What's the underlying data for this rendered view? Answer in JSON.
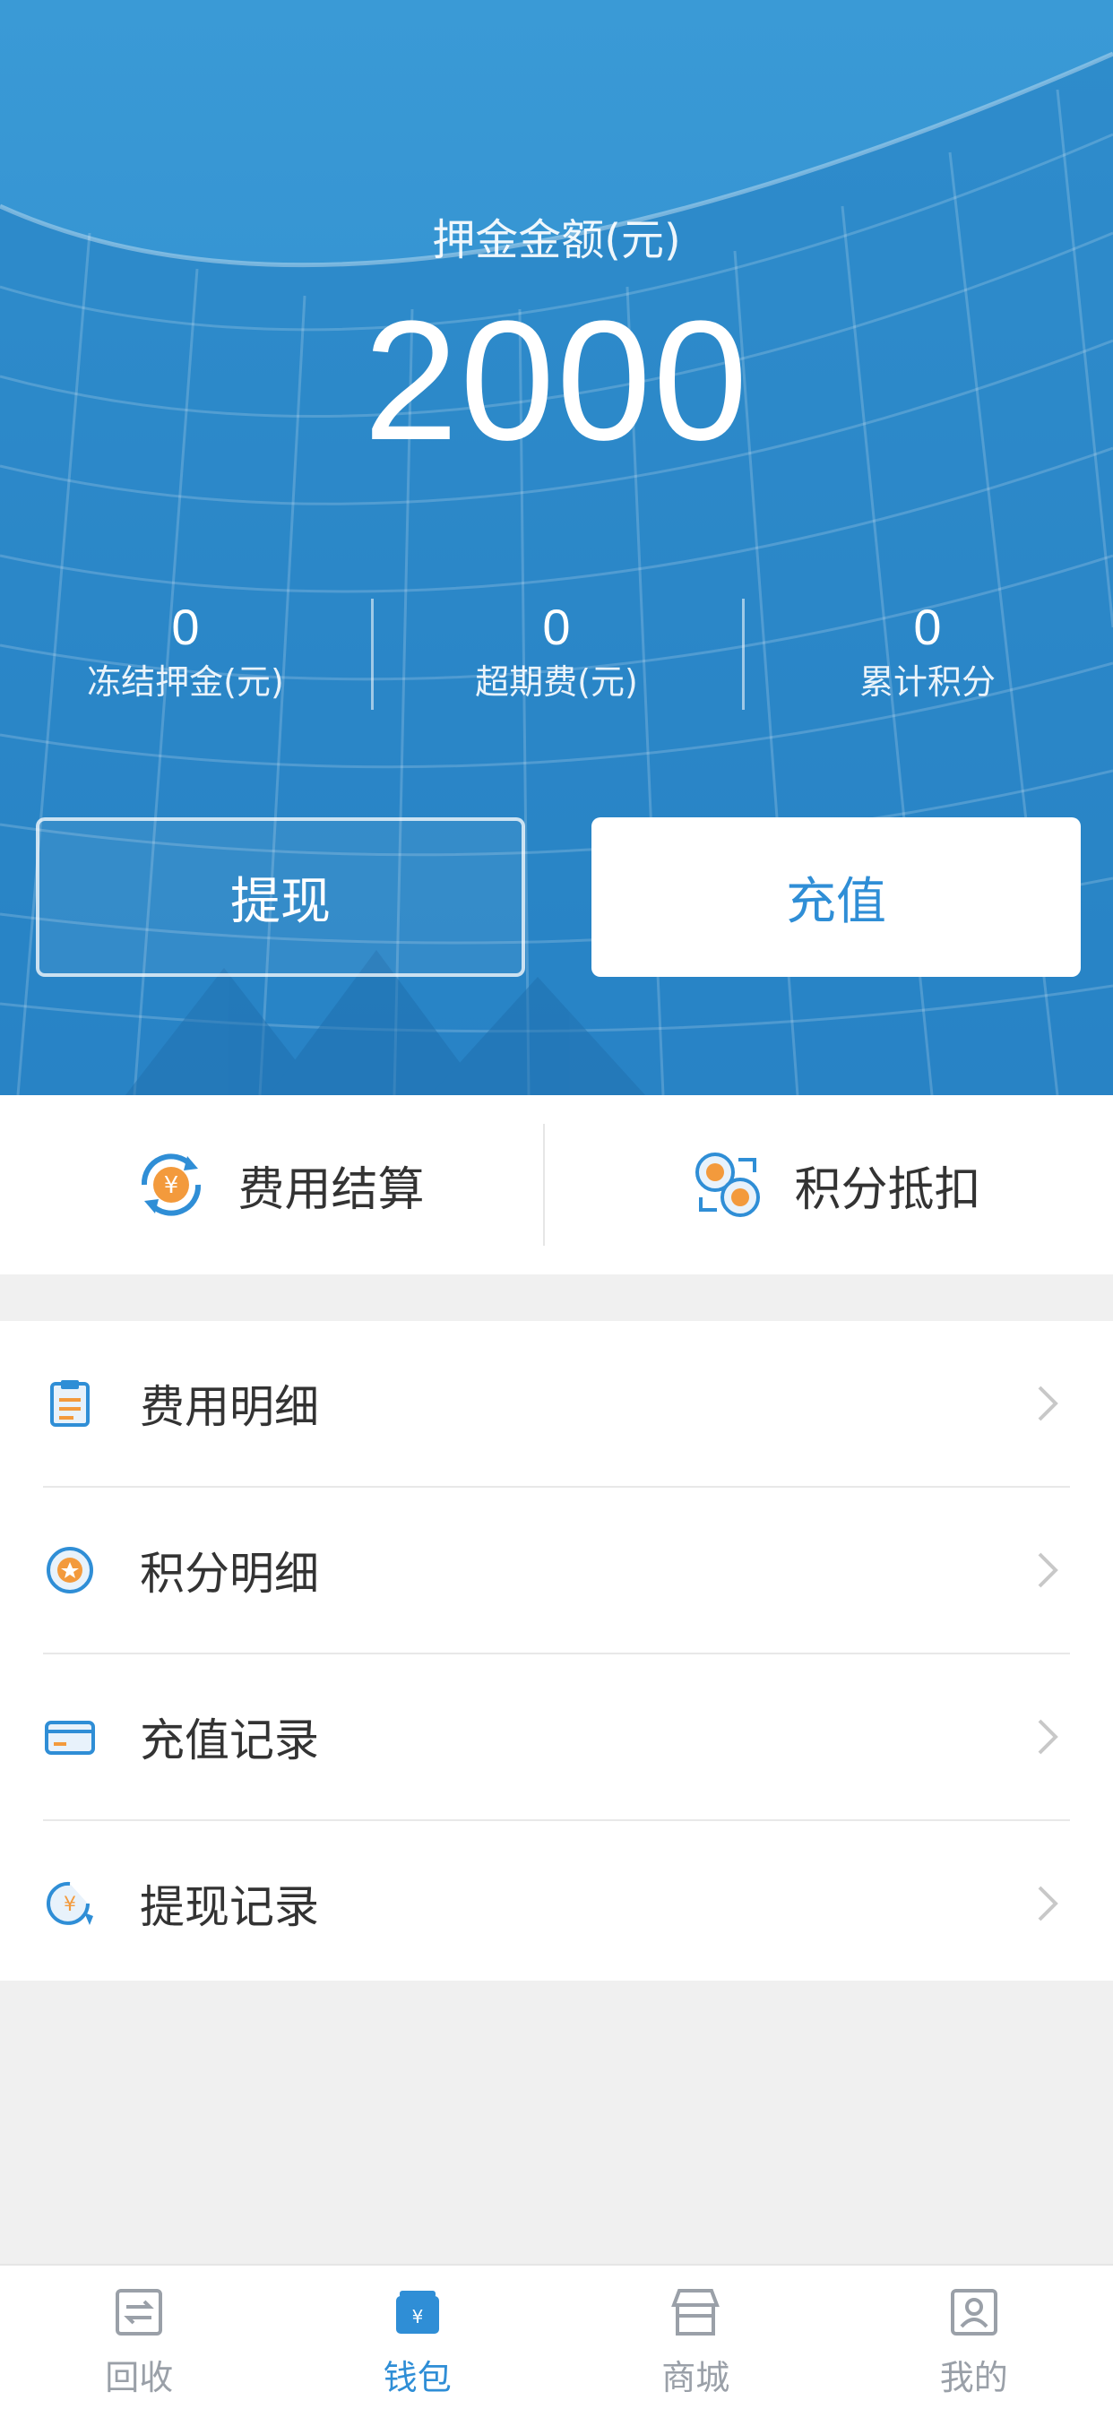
{
  "hero": {
    "label": "押金金额(元)",
    "amount": "2000",
    "stats": [
      {
        "value": "0",
        "label": "冻结押金(元)"
      },
      {
        "value": "0",
        "label": "超期费(元)"
      },
      {
        "value": "0",
        "label": "累计积分"
      }
    ],
    "withdraw_label": "提现",
    "recharge_label": "充值"
  },
  "quick_actions": [
    {
      "label": "费用结算",
      "icon": "yuan-cycle-icon"
    },
    {
      "label": "积分抵扣",
      "icon": "points-exchange-icon"
    }
  ],
  "menu": [
    {
      "label": "费用明细",
      "icon": "clipboard-icon"
    },
    {
      "label": "积分明细",
      "icon": "points-badge-icon"
    },
    {
      "label": "充值记录",
      "icon": "card-icon"
    },
    {
      "label": "提现记录",
      "icon": "yuan-return-icon"
    }
  ],
  "tabbar": [
    {
      "label": "回收",
      "icon": "recycle-swap-icon",
      "active": false
    },
    {
      "label": "钱包",
      "icon": "wallet-icon",
      "active": true
    },
    {
      "label": "商城",
      "icon": "store-icon",
      "active": false
    },
    {
      "label": "我的",
      "icon": "profile-icon",
      "active": false
    }
  ],
  "colors": {
    "accent": "#2f8ed6",
    "hero_bg": "#2a8cd0",
    "icon_orange": "#f39a3c",
    "tab_inactive": "#9aa0a8"
  }
}
